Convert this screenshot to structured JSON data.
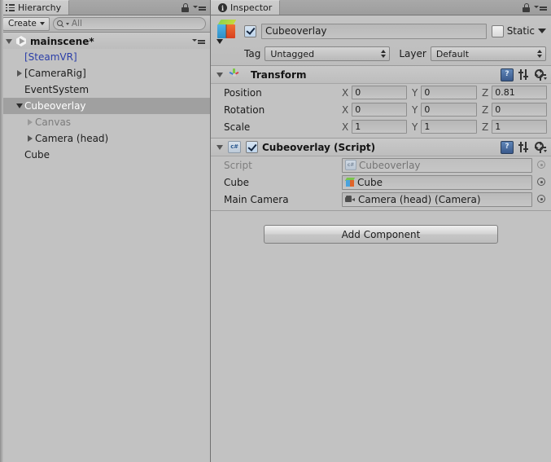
{
  "hierarchy": {
    "tab_label": "Hierarchy",
    "tab_icon": "list-icon",
    "lock_icon": "lock-icon",
    "options_icon": "options-menu-icon",
    "create_button": "Create",
    "search_placeholder": "All",
    "search_value": "",
    "scene_name": "mainscene*",
    "scene_icon": "unity-scene-icon",
    "items": [
      {
        "label": "[SteamVR]",
        "depth": 1,
        "twirl": "none",
        "style": "prefab"
      },
      {
        "label": "[CameraRig]",
        "depth": 1,
        "twirl": "right",
        "style": "prefab-normal"
      },
      {
        "label": "EventSystem",
        "depth": 1,
        "twirl": "none",
        "style": "normal"
      },
      {
        "label": "Cubeoverlay",
        "depth": 1,
        "twirl": "down",
        "style": "selected"
      },
      {
        "label": "Canvas",
        "depth": 2,
        "twirl": "right",
        "style": "disabled"
      },
      {
        "label": "Camera (head)",
        "depth": 2,
        "twirl": "right",
        "style": "normal"
      },
      {
        "label": "Cube",
        "depth": 1,
        "twirl": "none",
        "style": "normal"
      }
    ]
  },
  "inspector": {
    "tab_label": "Inspector",
    "tab_icon": "info-icon",
    "lock_icon": "lock-icon",
    "options_icon": "options-menu-icon",
    "gameobject": {
      "icon": "gameobject-cube-icon",
      "enabled": true,
      "name": "Cubeoverlay",
      "static_label": "Static",
      "static_checked": false,
      "tag_label": "Tag",
      "tag_value": "Untagged",
      "layer_label": "Layer",
      "layer_value": "Default"
    },
    "components": [
      {
        "id": "transform",
        "icon": "transform-gizmo-icon",
        "title": "Transform",
        "expanded": true,
        "has_checkbox": false,
        "rows": [
          {
            "label": "Position",
            "x": "0",
            "y": "0",
            "z": "0.81"
          },
          {
            "label": "Rotation",
            "x": "0",
            "y": "0",
            "z": "0"
          },
          {
            "label": "Scale",
            "x": "1",
            "y": "1",
            "z": "1"
          }
        ],
        "axis_labels": {
          "x": "X",
          "y": "Y",
          "z": "Z"
        },
        "header_icons": [
          "help-icon",
          "preset-icon",
          "gear-icon"
        ]
      },
      {
        "id": "cubeoverlay-script",
        "icon": "csharp-script-icon",
        "icon_text": "c#",
        "title": "Cubeoverlay (Script)",
        "expanded": true,
        "has_checkbox": true,
        "checked": true,
        "header_icons": [
          "help-icon",
          "preset-icon",
          "gear-icon"
        ],
        "fields": [
          {
            "label": "Script",
            "value": "Cubeoverlay",
            "icon": "script-asset-icon",
            "readonly": true
          },
          {
            "label": "Cube",
            "value": "Cube",
            "icon": "cube-object-icon",
            "readonly": false
          },
          {
            "label": "Main Camera",
            "value": "Camera (head) (Camera)",
            "icon": "camera-object-icon",
            "readonly": false
          }
        ]
      }
    ],
    "add_component_button": "Add Component"
  },
  "colors": {
    "panel_bg": "#c2c2c2",
    "selection": "#a0a0a0",
    "prefab_blue": "#2b3ea8",
    "disabled_text": "#7e7e7e",
    "border": "#8a8a8a"
  }
}
